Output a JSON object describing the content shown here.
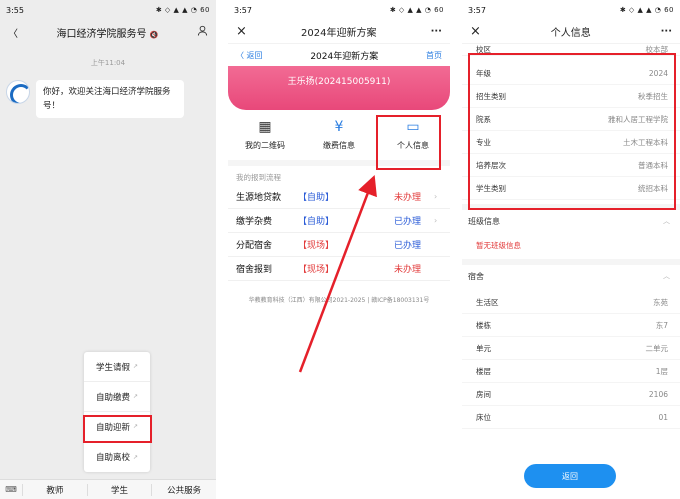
{
  "panel1": {
    "time": "3:55",
    "status_icons": "✱ ◇ ▲ ▲ ◔ 60",
    "back_icon": "chevron-left-icon",
    "title": "海口经济学院服务号",
    "title_suffix": "🔇",
    "profile_icon": "person-icon",
    "chat_time": "上午11:04",
    "message": "你好，欢迎关注海口经济学院服务号！",
    "menu_items": [
      "学生请假",
      "自助缴费",
      "自助迎新",
      "自助离校"
    ],
    "menu_ext": "↗",
    "bottom_tabs": [
      "教师",
      "学生",
      "公共服务"
    ],
    "bottom_kbd": "⌨"
  },
  "panel2": {
    "time": "3:57",
    "status_icons": "✱ ◇ ▲ ▲ ◔ 60",
    "close_icon": "×",
    "title": "2024年迎新方案",
    "more_icon": "···",
    "back_label": "〈 返回",
    "center_label": "2024年迎新方案",
    "home_label": "首页",
    "banner_name": "王乐扬(202415005911)",
    "icons": [
      {
        "glyph": "▦",
        "label": "我的二维码"
      },
      {
        "glyph": "¥",
        "label": "缴费信息"
      },
      {
        "glyph": "▭",
        "label": "个人信息"
      }
    ],
    "process_label": "我的报到流程",
    "process": [
      {
        "name": "生源地贷款",
        "type": "【自助】",
        "status": "未办理",
        "status_color": "#e23b3b",
        "type_color": "#2a5bd7",
        "chev": "›"
      },
      {
        "name": "缴学杂费",
        "type": "【自助】",
        "status": "已办理",
        "status_color": "#2a5bd7",
        "type_color": "#2a5bd7",
        "chev": "›"
      },
      {
        "name": "分配宿舍",
        "type": "【现场】",
        "status": "已办理",
        "status_color": "#2a5bd7",
        "type_color": "#e23b3b",
        "chev": ""
      },
      {
        "name": "宿舍报到",
        "type": "【现场】",
        "status": "未办理",
        "status_color": "#e23b3b",
        "type_color": "#e23b3b",
        "chev": ""
      }
    ],
    "footer": "华教教育科技（江西）有限公司2021-2025 | 赣ICP备18003131号"
  },
  "panel3": {
    "time": "3:57",
    "status_icons": "✱ ◇ ▲ ▲ ◔ 60",
    "close_icon": "×",
    "title": "个人信息",
    "more_icon": "···",
    "partial_row": {
      "k": "校区",
      "v": "校本部"
    },
    "highlight_rows": [
      {
        "k": "年级",
        "v": "2024"
      },
      {
        "k": "招生类别",
        "v": "秋季招生"
      },
      {
        "k": "院系",
        "v": "雅和人居工程学院"
      },
      {
        "k": "专业",
        "v": "土木工程本科"
      },
      {
        "k": "培养层次",
        "v": "普通本科"
      },
      {
        "k": "学生类别",
        "v": "统招本科"
      }
    ],
    "class_head": "班级信息",
    "class_empty": "暂无班级信息",
    "dorm_head": "宿舍",
    "caret": "︿",
    "dorm_rows": [
      {
        "k": "生活区",
        "v": "东苑"
      },
      {
        "k": "楼栋",
        "v": "东7"
      },
      {
        "k": "单元",
        "v": "二单元"
      },
      {
        "k": "楼层",
        "v": "1层"
      },
      {
        "k": "房间",
        "v": "2106"
      },
      {
        "k": "床位",
        "v": "01"
      }
    ],
    "return_label": "返回"
  },
  "colors": {
    "highlight_red": "#e5202a",
    "banner_pink": "#e8487a",
    "link_blue": "#2a7de1",
    "button_blue": "#1e90f0"
  }
}
